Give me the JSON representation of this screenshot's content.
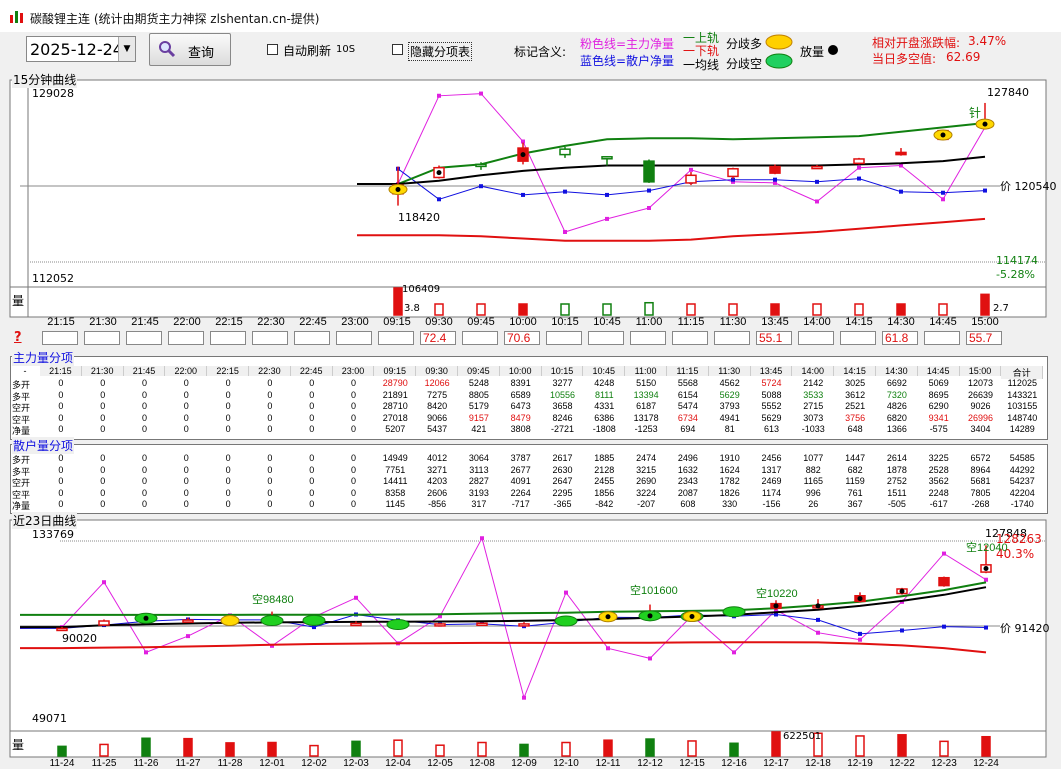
{
  "app": {
    "title": "碳酸锂主连 (统计由期货主力神探 zlshentan.cn-提供)"
  },
  "toolbar": {
    "date": "2025-12-24",
    "dropdown_arrow": "▼",
    "query_label": "查询",
    "auto_refresh_label": "自动刷新",
    "auto_refresh_suffix": "10S",
    "hide_split_label": "隐藏分项表",
    "legend_title": "标记含义:",
    "legend_pink": "粉色线=主力净量",
    "legend_blue": "蓝色线=散户净量",
    "legend_up": "一上轨",
    "legend_down": "一下轨",
    "legend_mid": "一均线",
    "legend_duo": "分歧多",
    "legend_kong": "分歧空",
    "legend_vol": "放量",
    "stat_pct_label": "相对开盘涨跌幅:",
    "stat_pct_value": "3.47%",
    "stat_val_label": "当日多空值:",
    "stat_val_value": "62.69"
  },
  "colors": {
    "pink": "#e020e0",
    "blue": "#1010e0",
    "red": "#e01010",
    "green": "#108010",
    "black": "#000000",
    "yellow": "#ffd800",
    "lime": "#20d020"
  },
  "chart15": {
    "title": "15分钟曲线",
    "y_max_label": "129028",
    "y_min_label": "112052",
    "high_label": "127840",
    "low_label": "118420",
    "pin_label": "针",
    "price_label": "价 120540",
    "base_label": "114174",
    "base_pct": "-5.28%",
    "vol_label": "量",
    "vol_max": "106409",
    "vol_first": "3.8",
    "vol_last": "2.7",
    "times": [
      "21:15",
      "21:30",
      "21:45",
      "22:00",
      "22:15",
      "22:30",
      "22:45",
      "23:00",
      "09:15",
      "09:30",
      "09:45",
      "10:00",
      "10:15",
      "10:45",
      "11:00",
      "11:15",
      "11:30",
      "13:45",
      "14:00",
      "14:15",
      "14:30",
      "14:45",
      "15:00"
    ],
    "strength": [
      "",
      "",
      "",
      "",
      "",
      "",
      "",
      "",
      "",
      "72.4",
      "",
      "70.6",
      "",
      "",
      "",
      "",
      "",
      "55.1",
      "",
      "",
      "61.8",
      "",
      "55.7"
    ],
    "help_icon": "?"
  },
  "main_table": {
    "title": "主力量分项",
    "corner": "-",
    "total_label": "合计",
    "row_labels": [
      "多开",
      "多平",
      "空开",
      "空平",
      "净量"
    ],
    "times": [
      "21:15",
      "21:30",
      "21:45",
      "22:00",
      "22:15",
      "22:30",
      "22:45",
      "23:00",
      "09:15",
      "09:30",
      "09:45",
      "10:00",
      "10:15",
      "10:45",
      "11:00",
      "11:15",
      "11:30",
      "13:45",
      "14:00",
      "14:15",
      "14:30",
      "14:45",
      "15:00",
      "合计"
    ],
    "rows": [
      [
        "0",
        "0",
        "0",
        "0",
        "0",
        "0",
        "0",
        "0",
        "28790",
        "12066",
        "5248",
        "8391",
        "3277",
        "4248",
        "5150",
        "5568",
        "4562",
        "5724",
        "2142",
        "3025",
        "6692",
        "5069",
        "12073",
        "112025"
      ],
      [
        "0",
        "0",
        "0",
        "0",
        "0",
        "0",
        "0",
        "0",
        "21891",
        "7275",
        "8805",
        "6589",
        "10556",
        "8111",
        "13394",
        "6154",
        "5629",
        "5088",
        "3533",
        "3612",
        "7320",
        "8695",
        "26639",
        "143321"
      ],
      [
        "0",
        "0",
        "0",
        "0",
        "0",
        "0",
        "0",
        "0",
        "28710",
        "8420",
        "5179",
        "6473",
        "3658",
        "4331",
        "6187",
        "5474",
        "3793",
        "5552",
        "2715",
        "2521",
        "4826",
        "6290",
        "9026",
        "103155"
      ],
      [
        "0",
        "0",
        "0",
        "0",
        "0",
        "0",
        "0",
        "0",
        "27018",
        "9066",
        "9157",
        "8479",
        "8246",
        "6386",
        "13178",
        "6734",
        "4941",
        "5629",
        "3073",
        "3756",
        "6820",
        "9341",
        "26996",
        "148740"
      ],
      [
        "0",
        "0",
        "0",
        "0",
        "0",
        "0",
        "0",
        "0",
        "5207",
        "5437",
        "421",
        "3808",
        "-2721",
        "-1808",
        "-1253",
        "694",
        "81",
        "613",
        "-1033",
        "648",
        "1366",
        "-575",
        "3404",
        "14289"
      ]
    ],
    "highlights": [
      {
        "r": 0,
        "c": 8,
        "color": "#e01010"
      },
      {
        "r": 0,
        "c": 9,
        "color": "#e01010"
      },
      {
        "r": 0,
        "c": 17,
        "color": "#e01010"
      },
      {
        "r": 1,
        "c": 12,
        "color": "#108010"
      },
      {
        "r": 1,
        "c": 13,
        "color": "#108010"
      },
      {
        "r": 1,
        "c": 14,
        "color": "#108010"
      },
      {
        "r": 1,
        "c": 16,
        "color": "#108010"
      },
      {
        "r": 1,
        "c": 18,
        "color": "#108010"
      },
      {
        "r": 1,
        "c": 20,
        "color": "#108010"
      },
      {
        "r": 3,
        "c": 10,
        "color": "#e01010"
      },
      {
        "r": 3,
        "c": 11,
        "color": "#e01010"
      },
      {
        "r": 3,
        "c": 15,
        "color": "#e01010"
      },
      {
        "r": 3,
        "c": 19,
        "color": "#e01010"
      },
      {
        "r": 3,
        "c": 21,
        "color": "#e01010"
      },
      {
        "r": 3,
        "c": 22,
        "color": "#e01010"
      }
    ]
  },
  "retail_table": {
    "title": "散户量分项",
    "row_labels": [
      "多开",
      "多平",
      "空开",
      "空平",
      "净量"
    ],
    "rows": [
      [
        "0",
        "0",
        "0",
        "0",
        "0",
        "0",
        "0",
        "0",
        "14949",
        "4012",
        "3064",
        "3787",
        "2617",
        "1885",
        "2474",
        "2496",
        "1910",
        "2456",
        "1077",
        "1447",
        "2614",
        "3225",
        "6572",
        "54585"
      ],
      [
        "0",
        "0",
        "0",
        "0",
        "0",
        "0",
        "0",
        "0",
        "7751",
        "3271",
        "3113",
        "2677",
        "2630",
        "2128",
        "3215",
        "1632",
        "1624",
        "1317",
        "882",
        "682",
        "1878",
        "2528",
        "8964",
        "44292"
      ],
      [
        "0",
        "0",
        "0",
        "0",
        "0",
        "0",
        "0",
        "0",
        "14411",
        "4203",
        "2827",
        "4091",
        "2647",
        "2455",
        "2690",
        "2343",
        "1782",
        "2469",
        "1165",
        "1159",
        "2752",
        "3562",
        "5681",
        "54237"
      ],
      [
        "0",
        "0",
        "0",
        "0",
        "0",
        "0",
        "0",
        "0",
        "8358",
        "2606",
        "3193",
        "2264",
        "2295",
        "1856",
        "3224",
        "2087",
        "1826",
        "1174",
        "996",
        "761",
        "1511",
        "2248",
        "7805",
        "42204"
      ],
      [
        "0",
        "0",
        "0",
        "0",
        "0",
        "0",
        "0",
        "0",
        "1145",
        "-856",
        "317",
        "-717",
        "-365",
        "-842",
        "-207",
        "608",
        "330",
        "-156",
        "26",
        "367",
        "-505",
        "-617",
        "-268",
        "-1740"
      ]
    ]
  },
  "chart23": {
    "title": "近23日曲线",
    "y_max_label": "133769",
    "y_min_label": "49071",
    "high_label": "127848",
    "cur_label": "128263",
    "pct_label": "40.3%",
    "low_label": "90020",
    "price_label": "价 91420",
    "vol_label": "量",
    "vol_max": "622501",
    "kong_labels": [
      {
        "day": 5,
        "text": "空98480"
      },
      {
        "day": 14,
        "text": "空101600"
      },
      {
        "day": 17,
        "text": "空10220"
      },
      {
        "day": 22,
        "text": "空12040"
      }
    ],
    "dates": [
      "11-24",
      "11-25",
      "11-26",
      "11-27",
      "11-28",
      "12-01",
      "12-02",
      "12-03",
      "12-04",
      "12-05",
      "12-08",
      "12-09",
      "12-10",
      "12-11",
      "12-12",
      "12-15",
      "12-16",
      "12-17",
      "12-18",
      "12-19",
      "12-22",
      "12-23",
      "12-24"
    ]
  },
  "chart_data": [
    {
      "type": "line",
      "title": "15分钟曲线",
      "x": [
        "09:15",
        "09:30",
        "09:45",
        "10:00",
        "10:15",
        "10:45",
        "11:00",
        "11:15",
        "11:30",
        "13:45",
        "14:00",
        "14:15",
        "14:30",
        "14:45",
        "15:00"
      ],
      "ylim": [
        112052,
        129028
      ],
      "candles": [
        {
          "o": 119500,
          "h": 122000,
          "l": 118420,
          "c": 120300
        },
        {
          "o": 121000,
          "h": 122100,
          "l": 120900,
          "c": 121900
        },
        {
          "o": 122200,
          "h": 122400,
          "l": 121700,
          "c": 122100
        },
        {
          "o": 122500,
          "h": 124200,
          "l": 122200,
          "c": 123700
        },
        {
          "o": 123600,
          "h": 123800,
          "l": 122800,
          "c": 123100
        },
        {
          "o": 122900,
          "h": 122950,
          "l": 122100,
          "c": 122800
        },
        {
          "o": 122500,
          "h": 122650,
          "l": 120500,
          "c": 120600
        },
        {
          "o": 120500,
          "h": 121500,
          "l": 120300,
          "c": 121200
        },
        {
          "o": 121100,
          "h": 121900,
          "l": 120900,
          "c": 121800
        },
        {
          "o": 121400,
          "h": 122200,
          "l": 121300,
          "c": 122000
        },
        {
          "o": 122000,
          "h": 122150,
          "l": 121800,
          "c": 122000
        },
        {
          "o": 122300,
          "h": 122800,
          "l": 122200,
          "c": 122700
        },
        {
          "o": 123100,
          "h": 123700,
          "l": 123000,
          "c": 123300
        },
        {
          "o": 124500,
          "h": 125400,
          "l": 124400,
          "c": 125300
        },
        {
          "o": 125800,
          "h": 127840,
          "l": 125500,
          "c": 126000
        }
      ],
      "series": [
        {
          "name": "粉色线=主力净量",
          "values": [
            120400,
            128500,
            128700,
            124300,
            116000,
            117200,
            118200,
            121700,
            120600,
            120500,
            118800,
            121900,
            122100,
            119000,
            125600
          ]
        },
        {
          "name": "蓝色线=散户净量",
          "values": [
            121800,
            119000,
            120200,
            119400,
            119700,
            119400,
            119800,
            120600,
            120800,
            120800,
            120600,
            120900,
            119700,
            119600,
            119800
          ]
        },
        {
          "name": "一上轨",
          "values": [
            120400,
            121900,
            122200,
            123200,
            123900,
            124500,
            124600,
            124600,
            124500,
            124600,
            124700,
            124800,
            125200,
            125600,
            126000
          ]
        },
        {
          "name": "一下轨",
          "values": [
            115700,
            115700,
            115600,
            115400,
            115200,
            115200,
            115200,
            115300,
            115600,
            115800,
            116000,
            116300,
            116600,
            116900,
            117200
          ]
        },
        {
          "name": "一均线",
          "values": [
            120400,
            120700,
            121200,
            121600,
            121900,
            122100,
            122100,
            122100,
            122100,
            122100,
            122100,
            122200,
            122300,
            122500,
            122900
          ]
        }
      ],
      "volume": {
        "x": [
          "09:15",
          "09:30",
          "09:45",
          "10:00",
          "10:15",
          "10:45",
          "11:00",
          "11:15",
          "11:30",
          "13:45",
          "14:00",
          "14:15",
          "14:30",
          "14:45",
          "15:00"
        ],
        "values": [
          106409,
          17000,
          15000,
          18000,
          13000,
          13000,
          22000,
          10000,
          7000,
          13000,
          6000,
          6000,
          14000,
          14000,
          37000
        ]
      }
    },
    {
      "type": "line",
      "title": "近23日曲线",
      "x": [
        "11-24",
        "11-25",
        "11-26",
        "11-27",
        "11-28",
        "12-01",
        "12-02",
        "12-03",
        "12-04",
        "12-05",
        "12-08",
        "12-09",
        "12-10",
        "12-11",
        "12-12",
        "12-15",
        "12-16",
        "12-17",
        "12-18",
        "12-19",
        "12-22",
        "12-23",
        "12-24"
      ],
      "ylim": [
        49071,
        133769
      ],
      "candles": [
        {
          "o": 91000,
          "h": 91700,
          "l": 90020,
          "c": 91000
        },
        {
          "o": 92500,
          "h": 95000,
          "l": 92000,
          "c": 94300
        },
        {
          "o": 95500,
          "h": 96500,
          "l": 94500,
          "c": 95500
        },
        {
          "o": 94700,
          "h": 95800,
          "l": 94200,
          "c": 94700
        },
        {
          "o": 94500,
          "h": 95200,
          "l": 93800,
          "c": 94500
        },
        {
          "o": 94500,
          "h": 98480,
          "l": 94000,
          "c": 94500
        },
        {
          "o": 94600,
          "h": 95200,
          "l": 94200,
          "c": 94600
        },
        {
          "o": 93200,
          "h": 94200,
          "l": 92800,
          "c": 93200
        },
        {
          "o": 92300,
          "h": 94200,
          "l": 92000,
          "c": 93200
        },
        {
          "o": 92700,
          "h": 93400,
          "l": 92000,
          "c": 93000
        },
        {
          "o": 92900,
          "h": 93600,
          "l": 92400,
          "c": 93300
        },
        {
          "o": 93000,
          "h": 93800,
          "l": 92200,
          "c": 93000
        },
        {
          "o": 93800,
          "h": 95200,
          "l": 93500,
          "c": 94800
        },
        {
          "o": 96200,
          "h": 97400,
          "l": 95600,
          "c": 96200
        },
        {
          "o": 96600,
          "h": 101600,
          "l": 96000,
          "c": 96600
        },
        {
          "o": 96300,
          "h": 97800,
          "l": 95800,
          "c": 96300
        },
        {
          "o": 98400,
          "h": 99000,
          "l": 98000,
          "c": 98400
        },
        {
          "o": 100000,
          "h": 103500,
          "l": 99200,
          "c": 102000
        },
        {
          "o": 101000,
          "h": 104000,
          "l": 100000,
          "c": 101000
        },
        {
          "o": 103000,
          "h": 107000,
          "l": 102500,
          "c": 105500
        },
        {
          "o": 106500,
          "h": 109000,
          "l": 106000,
          "c": 108500
        },
        {
          "o": 110000,
          "h": 114000,
          "l": 109500,
          "c": 113500
        },
        {
          "o": 116000,
          "h": 127848,
          "l": 115500,
          "c": 119200
        }
      ],
      "series": [
        {
          "name": "粉色线=主力净量",
          "values": [
            91600,
            111500,
            80400,
            87600,
            96800,
            83300,
            96100,
            104600,
            84400,
            96400,
            131000,
            60300,
            106900,
            82200,
            77700,
            96700,
            80400,
            99200,
            89100,
            86000,
            102800,
            124200,
            112600
          ]
        },
        {
          "name": "蓝色线=散户净量",
          "values": [
            91000,
            92500,
            94200,
            95000,
            94800,
            94800,
            91600,
            97200,
            94600,
            92700,
            93000,
            92000,
            93800,
            96000,
            95800,
            97000,
            96400,
            97200,
            94800,
            88600,
            90100,
            91800,
            91400
          ]
        },
        {
          "name": "一上轨",
          "values": [
            97000,
            97000,
            97000,
            97000,
            97000,
            97100,
            97100,
            97100,
            97200,
            97300,
            97600,
            97800,
            98000,
            98400,
            98600,
            98800,
            99100,
            100000,
            101300,
            102800,
            105300,
            108000,
            111400
          ]
        },
        {
          "name": "一下轨",
          "values": [
            82300,
            82500,
            82700,
            83000,
            83300,
            83800,
            84100,
            84300,
            84400,
            84500,
            84600,
            84600,
            84600,
            84700,
            84700,
            84800,
            84900,
            84900,
            84800,
            84300,
            83500,
            82300,
            80400
          ]
        },
        {
          "name": "一均线",
          "values": [
            91600,
            92400,
            92900,
            93200,
            93500,
            93700,
            93800,
            93900,
            94000,
            94100,
            94200,
            94400,
            94700,
            95200,
            95700,
            96300,
            97000,
            98200,
            99300,
            101000,
            103200,
            105900,
            109300
          ]
        }
      ],
      "volume": {
        "x": [
          "11-24",
          "11-25",
          "11-26",
          "11-27",
          "11-28",
          "12-01",
          "12-02",
          "12-03",
          "12-04",
          "12-05",
          "12-08",
          "12-09",
          "12-10",
          "12-11",
          "12-12",
          "12-15",
          "12-16",
          "12-17",
          "12-18",
          "12-19",
          "12-22",
          "12-23",
          "12-24"
        ],
        "values": [
          250000,
          300000,
          460000,
          450000,
          340000,
          350000,
          270000,
          380000,
          410000,
          280000,
          350000,
          300000,
          350000,
          410000,
          440000,
          390000,
          330000,
          622501,
          590000,
          520000,
          550000,
          380000,
          500000
        ]
      }
    }
  ]
}
